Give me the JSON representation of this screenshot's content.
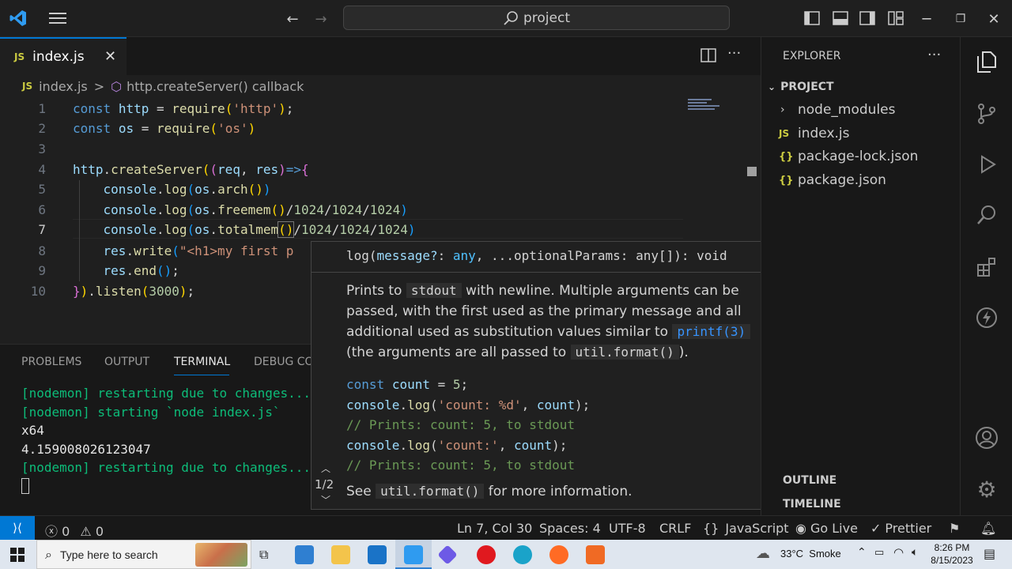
{
  "titlebar": {
    "search_text": "project"
  },
  "tab": {
    "label": "index.js",
    "badge": "JS"
  },
  "breadcrumb": {
    "badge": "JS",
    "file": "index.js",
    "sep": ">",
    "symbol": "http.createServer() callback"
  },
  "editor": {
    "line_numbers": [
      "1",
      "2",
      "3",
      "4",
      "5",
      "6",
      "7",
      "8",
      "9",
      "10"
    ]
  },
  "hover": {
    "signature": "log(message?: any, ...optionalParams: any[]): void",
    "desc_line1_a": "Prints to ",
    "desc_code1": "stdout",
    "desc_line1_b": " with newline. Multiple arguments can be",
    "desc_line2": "passed, with the first used as the primary message and all",
    "desc_line3_a": "additional used as substitution values similar to ",
    "desc_code2": "printf(3)",
    "desc_line4_a": "(the arguments are all passed to ",
    "desc_code3": "util.format()",
    "desc_line4_b": ").",
    "ex_comment": "// Prints: count: 5, to stdout",
    "pager": "1/2",
    "footer_a": "See ",
    "footer_code": "util.format()",
    "footer_b": " for more information."
  },
  "panel": {
    "tabs": [
      "PROBLEMS",
      "OUTPUT",
      "TERMINAL",
      "DEBUG CO"
    ],
    "active_tab": "TERMINAL",
    "terminal": [
      "[nodemon] restarting due to changes...",
      "[nodemon] starting `node index.js`",
      "x64",
      "4.159008026123047",
      "[nodemon] restarting due to changes..."
    ]
  },
  "explorer": {
    "title": "EXPLORER",
    "project": "PROJECT",
    "items": [
      {
        "label": "node_modules",
        "icon": "chevron-right-icon"
      },
      {
        "label": "index.js",
        "icon": "JS"
      },
      {
        "label": "package-lock.json",
        "icon": "{ }"
      },
      {
        "label": "package.json",
        "icon": "{ }"
      }
    ],
    "outline": "OUTLINE",
    "timeline": "TIMELINE"
  },
  "statusbar": {
    "errors": "0",
    "warnings": "0",
    "position": "Ln 7, Col 30",
    "spaces": "Spaces: 4",
    "encoding": "UTF-8",
    "eol": "CRLF",
    "language": "JavaScript",
    "golive": "Go Live",
    "prettier": "Prettier"
  },
  "taskbar": {
    "search_placeholder": "Type here to search",
    "weather": "33°C  Smoke",
    "time": "8:26 PM",
    "date": "8/15/2023"
  },
  "colors": {
    "accent": "#0078d4",
    "remote": "#0078d4",
    "editor_bg": "#1f1f1f",
    "panel_bg": "#181818",
    "taskbar_bg": "#dfe6ef"
  }
}
